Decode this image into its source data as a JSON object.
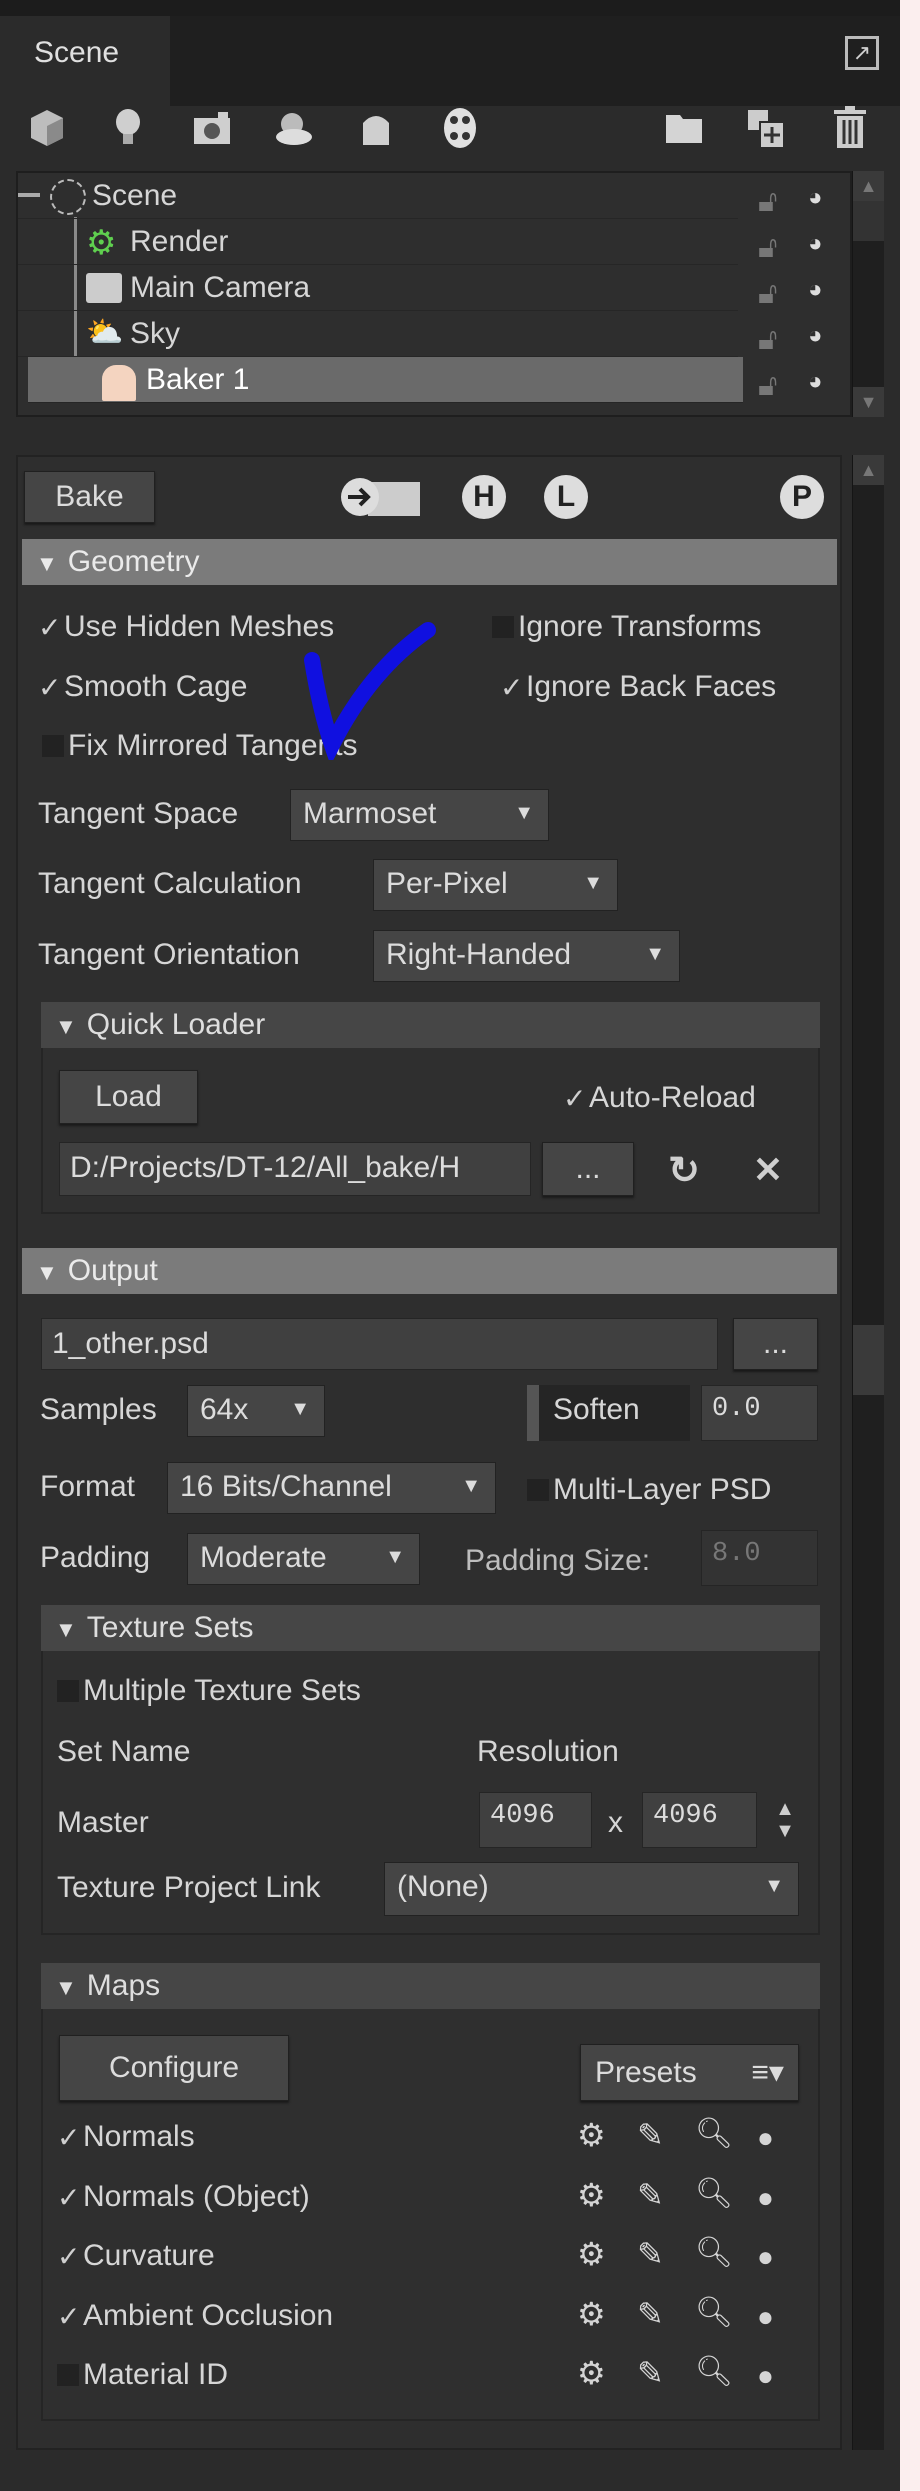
{
  "tab": {
    "label": "Scene"
  },
  "toolbar": {
    "left_icons": [
      "cube-icon",
      "light-bulb-icon",
      "camera-icon",
      "sky-icon",
      "baker-icon",
      "material-palette-icon"
    ],
    "right_icons": [
      "folder-icon",
      "duplicate-icon",
      "trash-icon"
    ]
  },
  "tree": {
    "items": [
      {
        "label": "Scene",
        "icon": "scene-icon",
        "selected": false
      },
      {
        "label": "Render",
        "icon": "render-gear-icon",
        "selected": false
      },
      {
        "label": "Main Camera",
        "icon": "camera-icon",
        "selected": false
      },
      {
        "label": "Sky",
        "icon": "sky-icon",
        "selected": false
      },
      {
        "label": "Baker 1",
        "icon": "baker-icon",
        "selected": true
      }
    ]
  },
  "bake": {
    "button": "Bake",
    "icons": [
      "export-folder-icon",
      "high-poly-icon",
      "low-poly-icon",
      "preview-icon"
    ],
    "H": "H",
    "L": "L",
    "P": "P"
  },
  "geometry": {
    "title": "Geometry",
    "use_hidden_meshes": {
      "label": "Use Hidden Meshes",
      "checked": true
    },
    "ignore_transforms": {
      "label": "Ignore Transforms",
      "checked": false
    },
    "smooth_cage": {
      "label": "Smooth Cage",
      "checked": true
    },
    "ignore_back_faces": {
      "label": "Ignore Back Faces",
      "checked": true
    },
    "fix_mirrored": {
      "label": "Fix Mirrored Tangents",
      "checked": false
    },
    "tangent_space": {
      "label": "Tangent Space",
      "value": "Marmoset"
    },
    "tangent_calc": {
      "label": "Tangent Calculation",
      "value": "Per-Pixel"
    },
    "tangent_orient": {
      "label": "Tangent Orientation",
      "value": "Right-Handed"
    },
    "annotation_color": "#1010e0"
  },
  "quick_loader": {
    "title": "Quick Loader",
    "load": "Load",
    "auto_reload": {
      "label": "Auto-Reload",
      "checked": true
    },
    "path": "D:/Projects/DT-12/All_bake/H",
    "browse": "..."
  },
  "output": {
    "title": "Output",
    "filename": "1_other.psd",
    "browse": "...",
    "samples": {
      "label": "Samples",
      "value": "64x"
    },
    "soften": {
      "label": "Soften",
      "value": "0.0"
    },
    "format": {
      "label": "Format",
      "value": "16 Bits/Channel"
    },
    "multilayer": {
      "label": "Multi-Layer PSD",
      "checked": false
    },
    "padding": {
      "label": "Padding",
      "value": "Moderate"
    },
    "padding_size": {
      "label": "Padding Size:",
      "value": "8.0"
    }
  },
  "texture_sets": {
    "title": "Texture Sets",
    "multiple": {
      "label": "Multiple Texture Sets",
      "checked": false
    },
    "set_name_hdr": "Set Name",
    "resolution_hdr": "Resolution",
    "set_name": "Master",
    "width": "4096",
    "x": "x",
    "height": "4096",
    "project_link": {
      "label": "Texture Project Link",
      "value": "(None)"
    }
  },
  "maps": {
    "title": "Maps",
    "configure": "Configure",
    "presets": "Presets",
    "presets_icon": "≡▾",
    "items": [
      {
        "label": "Normals",
        "checked": true
      },
      {
        "label": "Normals (Object)",
        "checked": true
      },
      {
        "label": "Curvature",
        "checked": true
      },
      {
        "label": "Ambient Occlusion",
        "checked": true
      },
      {
        "label": "Material ID",
        "checked": false
      }
    ]
  }
}
